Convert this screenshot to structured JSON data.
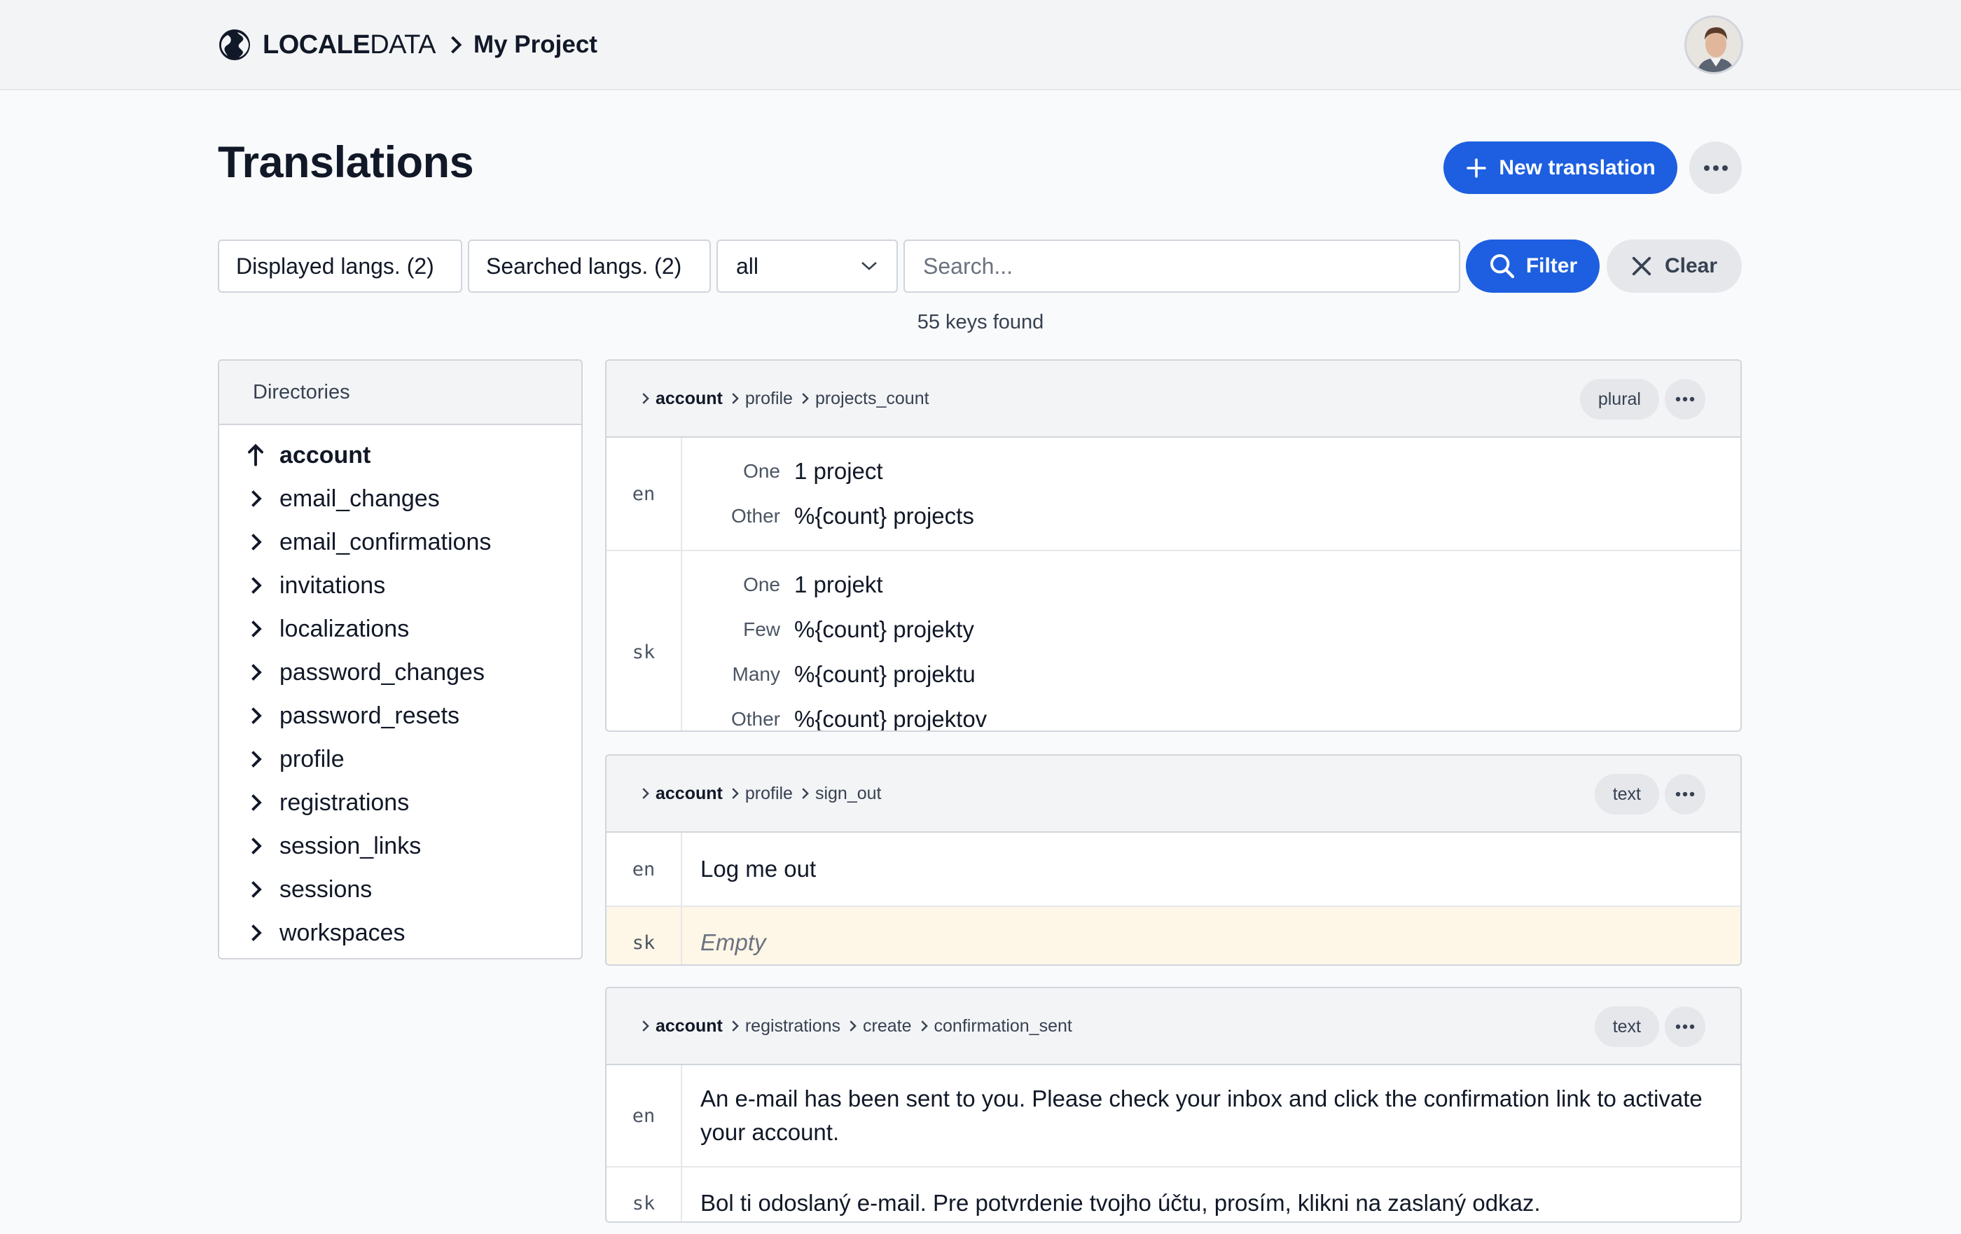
{
  "header": {
    "brand_bold": "LOCALE",
    "brand_light": "DATA",
    "project": "My Project",
    "avatar_icon": "user-avatar"
  },
  "page": {
    "title": "Translations",
    "new_translation_label": "New translation"
  },
  "filters": {
    "displayed_langs": "Displayed langs. (2)",
    "searched_langs": "Searched langs. (2)",
    "scope_selected": "all",
    "search_placeholder": "Search...",
    "filter_label": "Filter",
    "clear_label": "Clear",
    "keys_found": "55 keys found"
  },
  "directories": {
    "title": "Directories",
    "current": "account",
    "items": [
      "email_changes",
      "email_confirmations",
      "invitations",
      "localizations",
      "password_changes",
      "password_resets",
      "profile",
      "registrations",
      "session_links",
      "sessions",
      "workspaces"
    ]
  },
  "keys": [
    {
      "path": [
        "account",
        "profile",
        "projects_count"
      ],
      "type": "plural",
      "translations": [
        {
          "lang": "en",
          "forms": [
            {
              "form": "One",
              "text": "1 project"
            },
            {
              "form": "Other",
              "text": "%{count} projects"
            }
          ]
        },
        {
          "lang": "sk",
          "forms": [
            {
              "form": "One",
              "text": "1 projekt"
            },
            {
              "form": "Few",
              "text": "%{count} projekty"
            },
            {
              "form": "Many",
              "text": "%{count} projektu"
            },
            {
              "form": "Other",
              "text": "%{count} projektov"
            }
          ]
        }
      ]
    },
    {
      "path": [
        "account",
        "profile",
        "sign_out"
      ],
      "type": "text",
      "translations": [
        {
          "lang": "en",
          "text": "Log me out"
        },
        {
          "lang": "sk",
          "text": "Empty",
          "empty": true
        }
      ]
    },
    {
      "path": [
        "account",
        "registrations",
        "create",
        "confirmation_sent"
      ],
      "type": "text",
      "translations": [
        {
          "lang": "en",
          "text": "An e-mail has been sent to you. Please check your inbox and click the confirmation link to activate your account."
        },
        {
          "lang": "sk",
          "text": "Bol ti odoslaný e-mail. Pre potvrdenie tvojho účtu, prosím, klikni na zaslaný odkaz."
        }
      ]
    }
  ],
  "colors": {
    "primary": "#1d5fe0",
    "empty_highlight": "#fef6e7"
  }
}
